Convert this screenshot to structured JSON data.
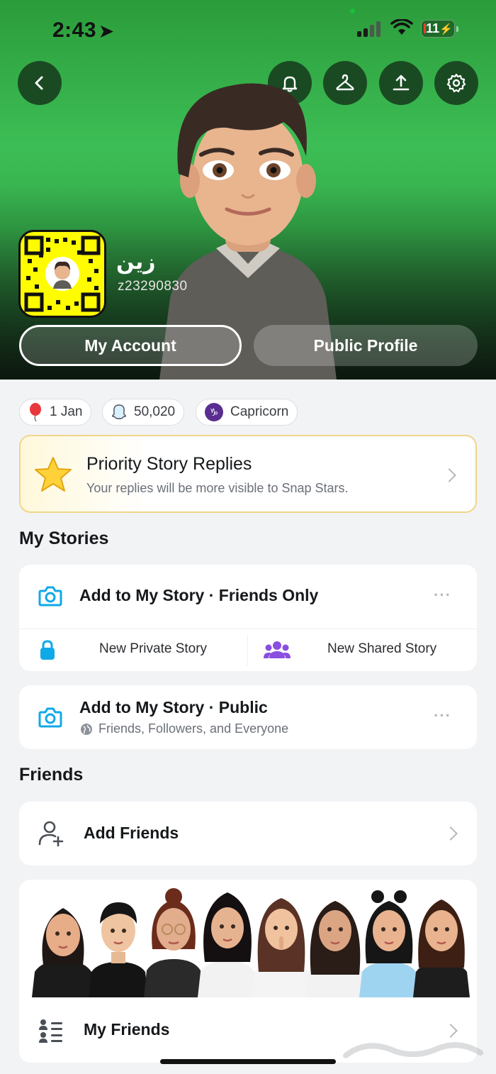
{
  "status_bar": {
    "time": "2:43",
    "battery": "11"
  },
  "header": {
    "back_icon": "chevron-left-icon",
    "actions": [
      "bell-icon",
      "hanger-icon",
      "share-upload-icon",
      "gear-icon"
    ],
    "display_name": "زين",
    "username": "z23290830",
    "my_account_label": "My Account",
    "public_profile_label": "Public Profile",
    "background_color": "#35ad4b"
  },
  "chips": {
    "birthday": "1 Jan",
    "score": "50,020",
    "zodiac": "Capricorn"
  },
  "priority": {
    "title": "Priority Story Replies",
    "subtitle": "Your replies will be more visible to Snap Stars."
  },
  "my_stories": {
    "section_title": "My Stories",
    "friends_only": "Add to My Story · Friends Only",
    "new_private": "New Private Story",
    "new_shared": "New Shared Story",
    "public_title": "Add to My Story · Public",
    "public_sub": "Friends, Followers, and Everyone",
    "more": "···"
  },
  "friends": {
    "section_title": "Friends",
    "add_friends": "Add Friends",
    "my_friends": "My Friends"
  },
  "colors": {
    "accent_blue": "#10a9e8",
    "purple": "#8a4ee0",
    "snap_yellow": "#fffc00"
  }
}
